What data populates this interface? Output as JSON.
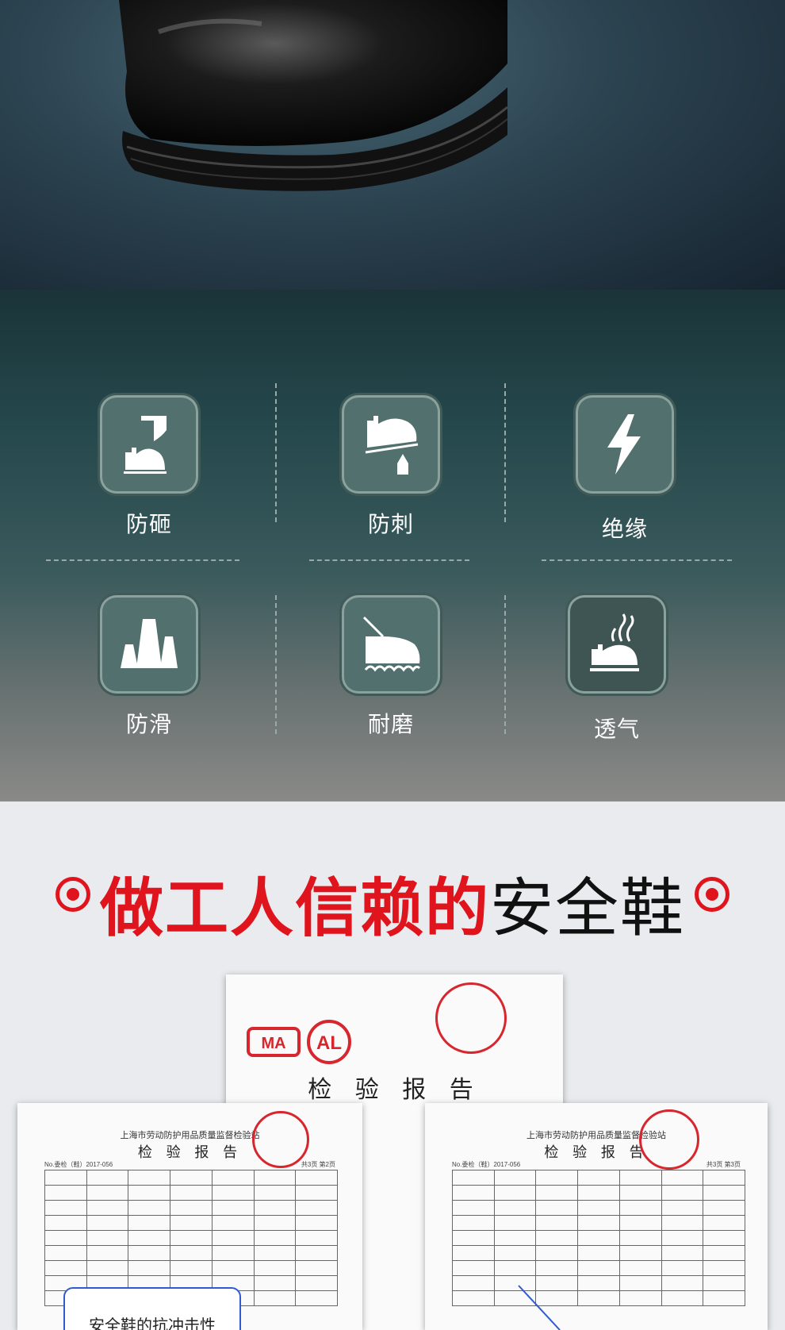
{
  "features": [
    {
      "label": "防砸",
      "icon": "anti-smash-icon"
    },
    {
      "label": "防刺",
      "icon": "anti-puncture-icon"
    },
    {
      "label": "绝缘",
      "icon": "insulation-lightning-icon"
    },
    {
      "label": "防滑",
      "icon": "anti-slip-icon"
    },
    {
      "label": "耐磨",
      "icon": "wear-resistant-icon"
    },
    {
      "label": "透气",
      "icon": "breathable-icon"
    }
  ],
  "heading": {
    "red": "做工人信赖的",
    "black": "安全鞋"
  },
  "report": {
    "title_large": "检 验 报 告",
    "title_small": "检 验 报 告",
    "org": "上海市劳动防护用品质量监督检验站",
    "report_no": "No.委检（鞋）2017-056",
    "page_left": "共3页 第2页",
    "page_right": "共3页 第3页",
    "callout": "安全鞋的抗冲击性"
  },
  "colors": {
    "accent": "#e0141d",
    "icon_bg": "#52706e",
    "callout_border": "#2f5bd1"
  }
}
